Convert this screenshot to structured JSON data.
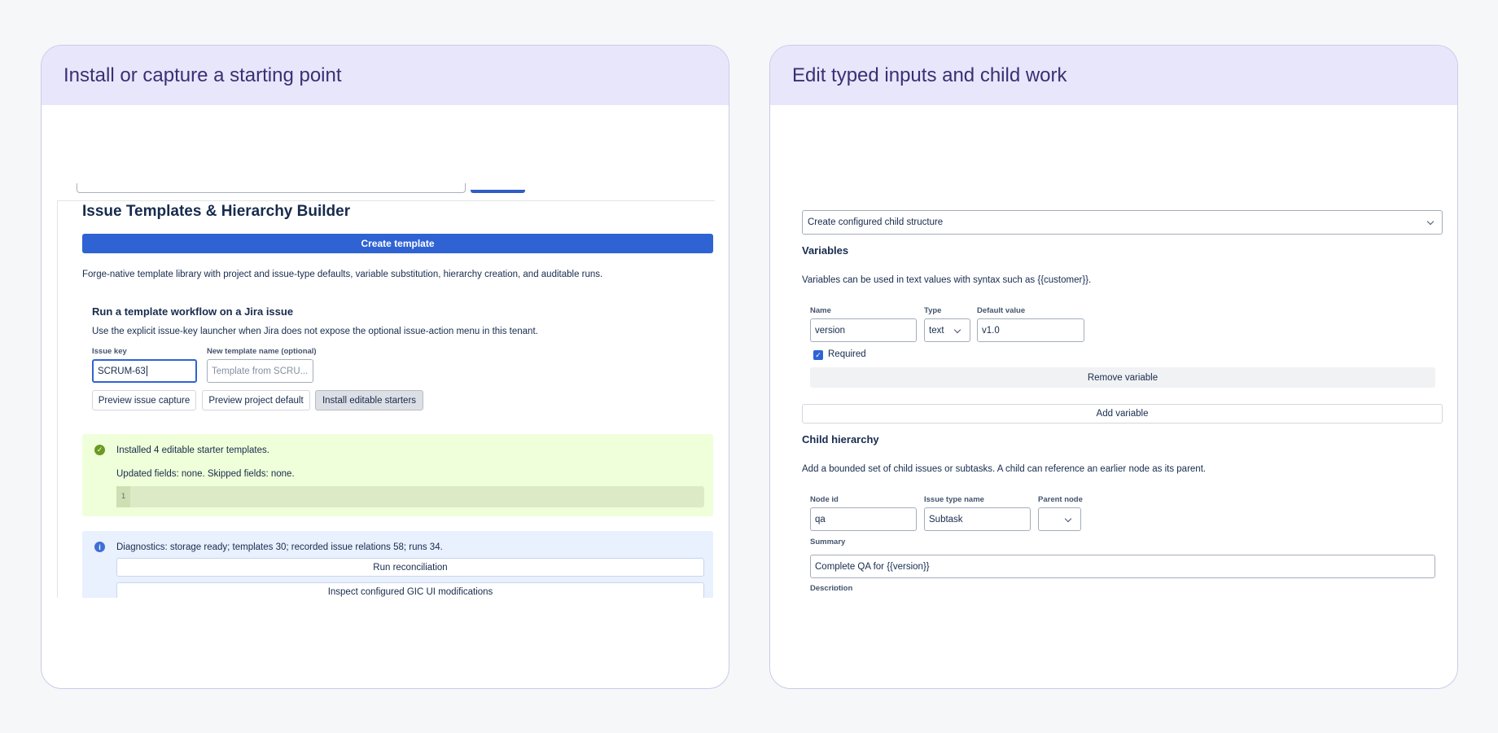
{
  "left_card": {
    "title": "Install or capture a starting point",
    "app_title": "Issue Templates & Hierarchy Builder",
    "create_template_label": "Create template",
    "description": "Forge-native template library with project and issue-type defaults, variable substitution, hierarchy creation, and auditable runs.",
    "workflow": {
      "title": "Run a template workflow on a Jira issue",
      "description": "Use the explicit issue-key launcher when Jira does not expose the optional issue-action menu in this tenant.",
      "issue_key_label": "Issue key",
      "issue_key_value": "SCRUM-63",
      "template_name_label": "New template name (optional)",
      "template_name_placeholder": "Template from SCRU...",
      "buttons": {
        "preview_capture": "Preview issue capture",
        "preview_default": "Preview project default",
        "install_starters": "Install editable starters"
      }
    },
    "success": {
      "message": "Installed 4 editable starter templates.",
      "detail": "Updated fields: none. Skipped fields: none.",
      "code_line_number": "1"
    },
    "diagnostics": {
      "message": "Diagnostics: storage ready; templates 30; recorded issue relations 58; runs 34.",
      "run_reconciliation": "Run reconciliation",
      "inspect_gic": "Inspect configured GIC UI modifications"
    }
  },
  "right_card": {
    "title": "Edit typed inputs and child work",
    "action_select": "Create configured child structure",
    "variables": {
      "heading": "Variables",
      "description": "Variables can be used in text values with syntax such as {{customer}}.",
      "name_label": "Name",
      "name_value": "version",
      "type_label": "Type",
      "type_value": "text",
      "default_label": "Default value",
      "default_value": "v1.0",
      "required_label": "Required",
      "required_checked": true,
      "remove_label": "Remove variable",
      "add_label": "Add variable"
    },
    "hierarchy": {
      "heading": "Child hierarchy",
      "description": "Add a bounded set of child issues or subtasks. A child can reference an earlier node as its parent.",
      "node_id_label": "Node id",
      "node_id_value": "qa",
      "issue_type_label": "Issue type name",
      "issue_type_value": "Subtask",
      "parent_label": "Parent node",
      "parent_value": "",
      "summary_label": "Summary",
      "summary_value": "Complete QA for {{version}}",
      "description_label": "Description"
    }
  },
  "colors": {
    "primary": "#2f63d4",
    "card_header": "#e8e6fb",
    "card_title": "#3b2f73",
    "success_bg": "#efffd9",
    "info_bg": "#e9f0fe"
  }
}
